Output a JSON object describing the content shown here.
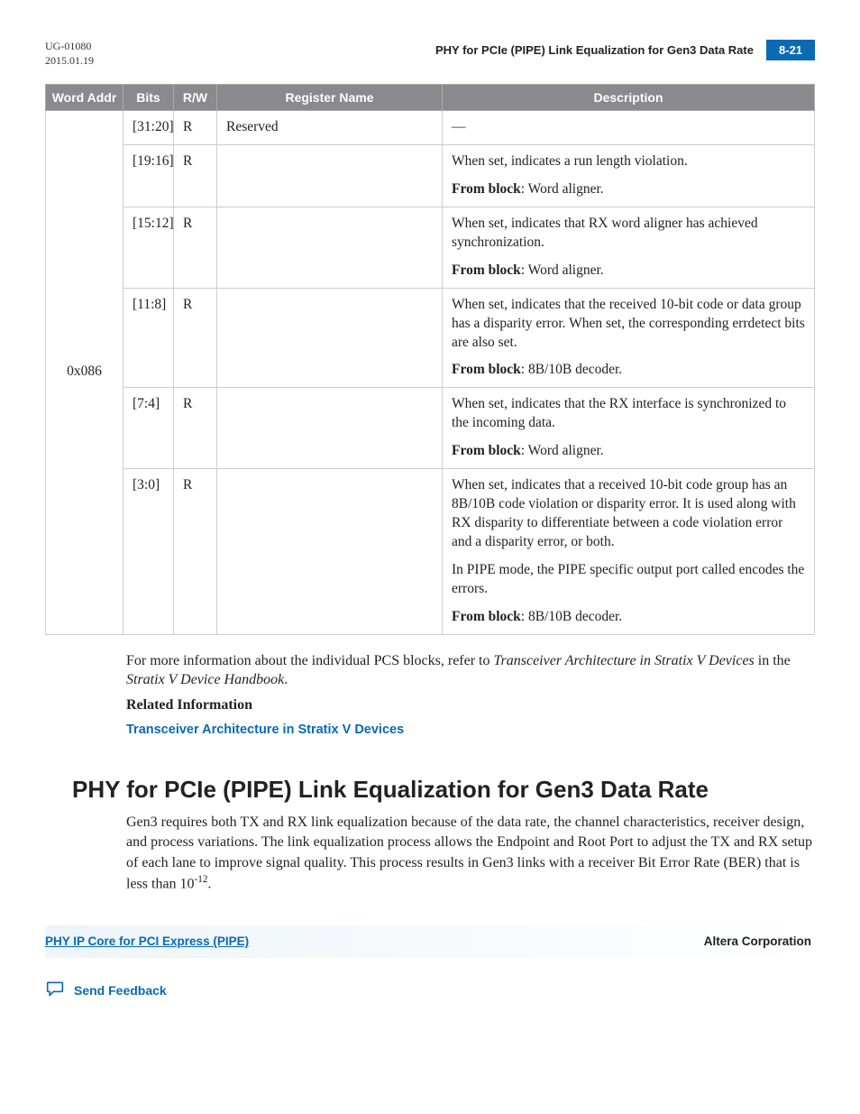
{
  "header": {
    "doc_id": "UG-01080",
    "date": "2015.01.19",
    "title": "PHY for PCIe (PIPE) Link Equalization for Gen3 Data Rate",
    "page": "8-21"
  },
  "table": {
    "headers": {
      "word_addr": "Word Addr",
      "bits": "Bits",
      "rw": "R/W",
      "register_name": "Register Name",
      "description": "Description"
    },
    "addr": "0x086",
    "rows": [
      {
        "bits": "[31:20]",
        "rw": "R",
        "name": "Reserved",
        "desc_plain": "—"
      },
      {
        "bits": "[19:16]",
        "rw": "R",
        "name": "",
        "desc_p1": "When set, indicates a run length violation.",
        "desc_fromblock_label": "From block",
        "desc_fromblock_value": ": Word aligner."
      },
      {
        "bits": "[15:12]",
        "rw": "R",
        "name": "",
        "desc_p1": "When set, indicates that RX word aligner has achieved synchronization.",
        "desc_fromblock_label": "From block",
        "desc_fromblock_value": ": Word aligner."
      },
      {
        "bits": "[11:8]",
        "rw": "R",
        "name": "",
        "desc_p1": "When set, indicates that the received 10-bit code or data group has a disparity error. When set, the corresponding errdetect bits are also set.",
        "desc_fromblock_label": "From block",
        "desc_fromblock_value": ": 8B/10B decoder."
      },
      {
        "bits": "[7:4]",
        "rw": "R",
        "name": "",
        "desc_p1": "When set, indicates that the RX interface is synchronized to the incoming data.",
        "desc_fromblock_label": "From block",
        "desc_fromblock_value": ": Word aligner."
      },
      {
        "bits": "[3:0]",
        "rw": "R",
        "name": "",
        "desc_p1": "When set, indicates that a received 10-bit code group has an 8B/10B code violation or disparity error. It is used along with RX disparity to differentiate between a code violation error and a disparity error, or both.",
        "desc_p2_a": "In PIPE mode, the PIPE specific output port called ",
        "desc_p2_b": " encodes the errors.",
        "desc_fromblock_label": "From block",
        "desc_fromblock_value": ": 8B/10B decoder."
      }
    ]
  },
  "after_table": {
    "para_a": "For more information about the individual PCS blocks, refer to ",
    "para_italic1": "Transceiver Architecture in Stratix V Devices",
    "para_b": " in the ",
    "para_italic2": "Stratix V Device Handbook",
    "para_c": ".",
    "related_label": "Related Information",
    "related_link": "Transceiver Architecture in Stratix V Devices"
  },
  "section": {
    "heading": "PHY for PCIe (PIPE) Link Equalization for Gen3 Data Rate",
    "para_a": "Gen3 requires both TX and RX link equalization because of the data rate, the channel characteristics, receiver design, and process variations. The link equalization process allows the Endpoint and Root Port to adjust the TX and RX setup of each lane to improve signal quality. This process results in Gen3 links with a receiver Bit Error Rate (BER) that is less than 10",
    "para_sup": "-12",
    "para_b": "."
  },
  "footer": {
    "left": "PHY IP Core for PCI Express (PIPE)",
    "right": "Altera Corporation"
  },
  "feedback": {
    "label": "Send Feedback"
  }
}
